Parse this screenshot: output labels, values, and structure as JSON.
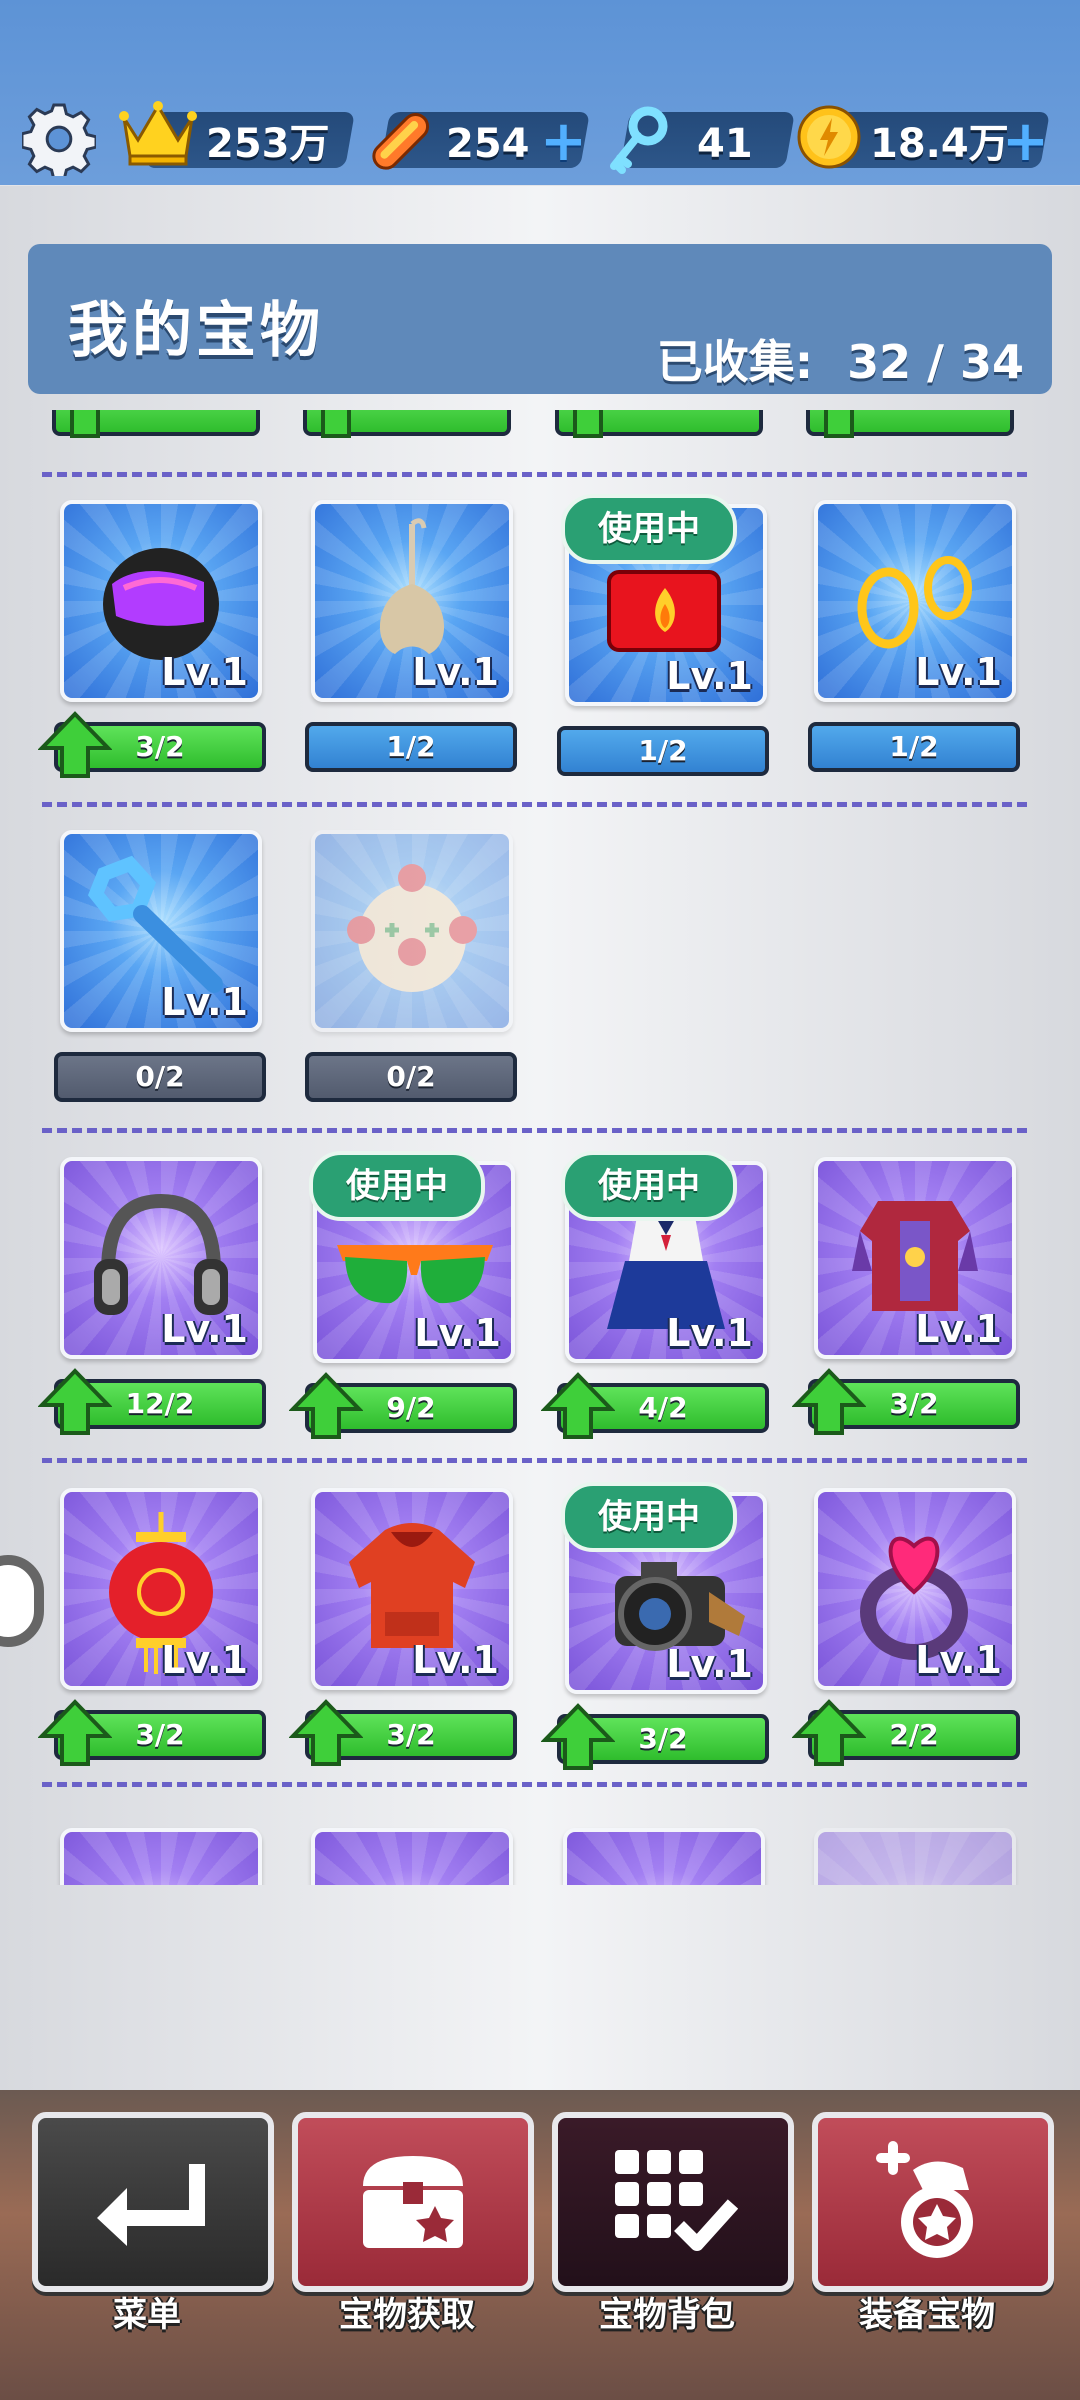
{
  "resources": {
    "crown_value": "253万",
    "board_value": "254",
    "key_value": "41",
    "coin_value": "18.4万",
    "plus": "+"
  },
  "header": {
    "title": "我的宝物",
    "collected_label": "已收集:",
    "collected_value": "32 / 34"
  },
  "badge_in_use": "使用中",
  "level_text": "Lv.1",
  "rows": [
    {
      "items": [
        {
          "name": "helmet-item",
          "icon": "racing-helmet-icon",
          "progress": "3/2",
          "bar": "green",
          "upgrade": true,
          "in_use": false
        },
        {
          "name": "mop-item",
          "icon": "mop-icon",
          "progress": "1/2",
          "bar": "blue",
          "upgrade": false,
          "in_use": false
        },
        {
          "name": "fire-box-item",
          "icon": "fire-box-icon",
          "progress": "1/2",
          "bar": "blue",
          "upgrade": false,
          "in_use": true
        },
        {
          "name": "rings-item",
          "icon": "gold-rings-icon",
          "progress": "1/2",
          "bar": "blue",
          "upgrade": false,
          "in_use": false
        }
      ]
    },
    {
      "items": [
        {
          "name": "windup-key-item",
          "icon": "windup-key-icon",
          "progress": "0/2",
          "bar": "gray",
          "upgrade": false,
          "in_use": false
        },
        {
          "name": "clown-item",
          "icon": "clown-face-icon",
          "progress": "0/2",
          "bar": "gray",
          "upgrade": false,
          "in_use": false,
          "locked": true
        }
      ]
    },
    {
      "items": [
        {
          "name": "headphones-item",
          "icon": "headphones-icon",
          "progress": "12/2",
          "bar": "green",
          "upgrade": true,
          "in_use": false
        },
        {
          "name": "sunglasses-item",
          "icon": "sunglasses-icon",
          "progress": "9/2",
          "bar": "green",
          "upgrade": true,
          "in_use": true
        },
        {
          "name": "school-uniform-item",
          "icon": "sailor-uniform-icon",
          "progress": "4/2",
          "bar": "green",
          "upgrade": true,
          "in_use": true
        },
        {
          "name": "armor-item",
          "icon": "armor-icon",
          "progress": "3/2",
          "bar": "green",
          "upgrade": true,
          "in_use": false
        }
      ]
    },
    {
      "items": [
        {
          "name": "lantern-item",
          "icon": "red-lantern-icon",
          "progress": "3/2",
          "bar": "green",
          "upgrade": true,
          "in_use": false
        },
        {
          "name": "hoodie-item",
          "icon": "hoodie-icon",
          "progress": "3/2",
          "bar": "green",
          "upgrade": true,
          "in_use": false
        },
        {
          "name": "camera-item",
          "icon": "camera-icon",
          "progress": "3/2",
          "bar": "green",
          "upgrade": true,
          "in_use": true
        },
        {
          "name": "heart-ring-item",
          "icon": "heart-ring-icon",
          "progress": "2/2",
          "bar": "green",
          "upgrade": true,
          "in_use": false
        }
      ]
    }
  ],
  "nav": {
    "menu": "菜单",
    "acquire": "宝物获取",
    "backpack": "宝物背包",
    "equip": "装备宝物"
  },
  "colors": {
    "top_bg": "#6b9bd8",
    "header_bg": "#5f89ba",
    "progress_green": "#3fcf3a",
    "progress_blue": "#3d8fdc",
    "progress_gray": "#5c6578",
    "badge_green": "#2aa073",
    "separator": "#6a61c8"
  }
}
